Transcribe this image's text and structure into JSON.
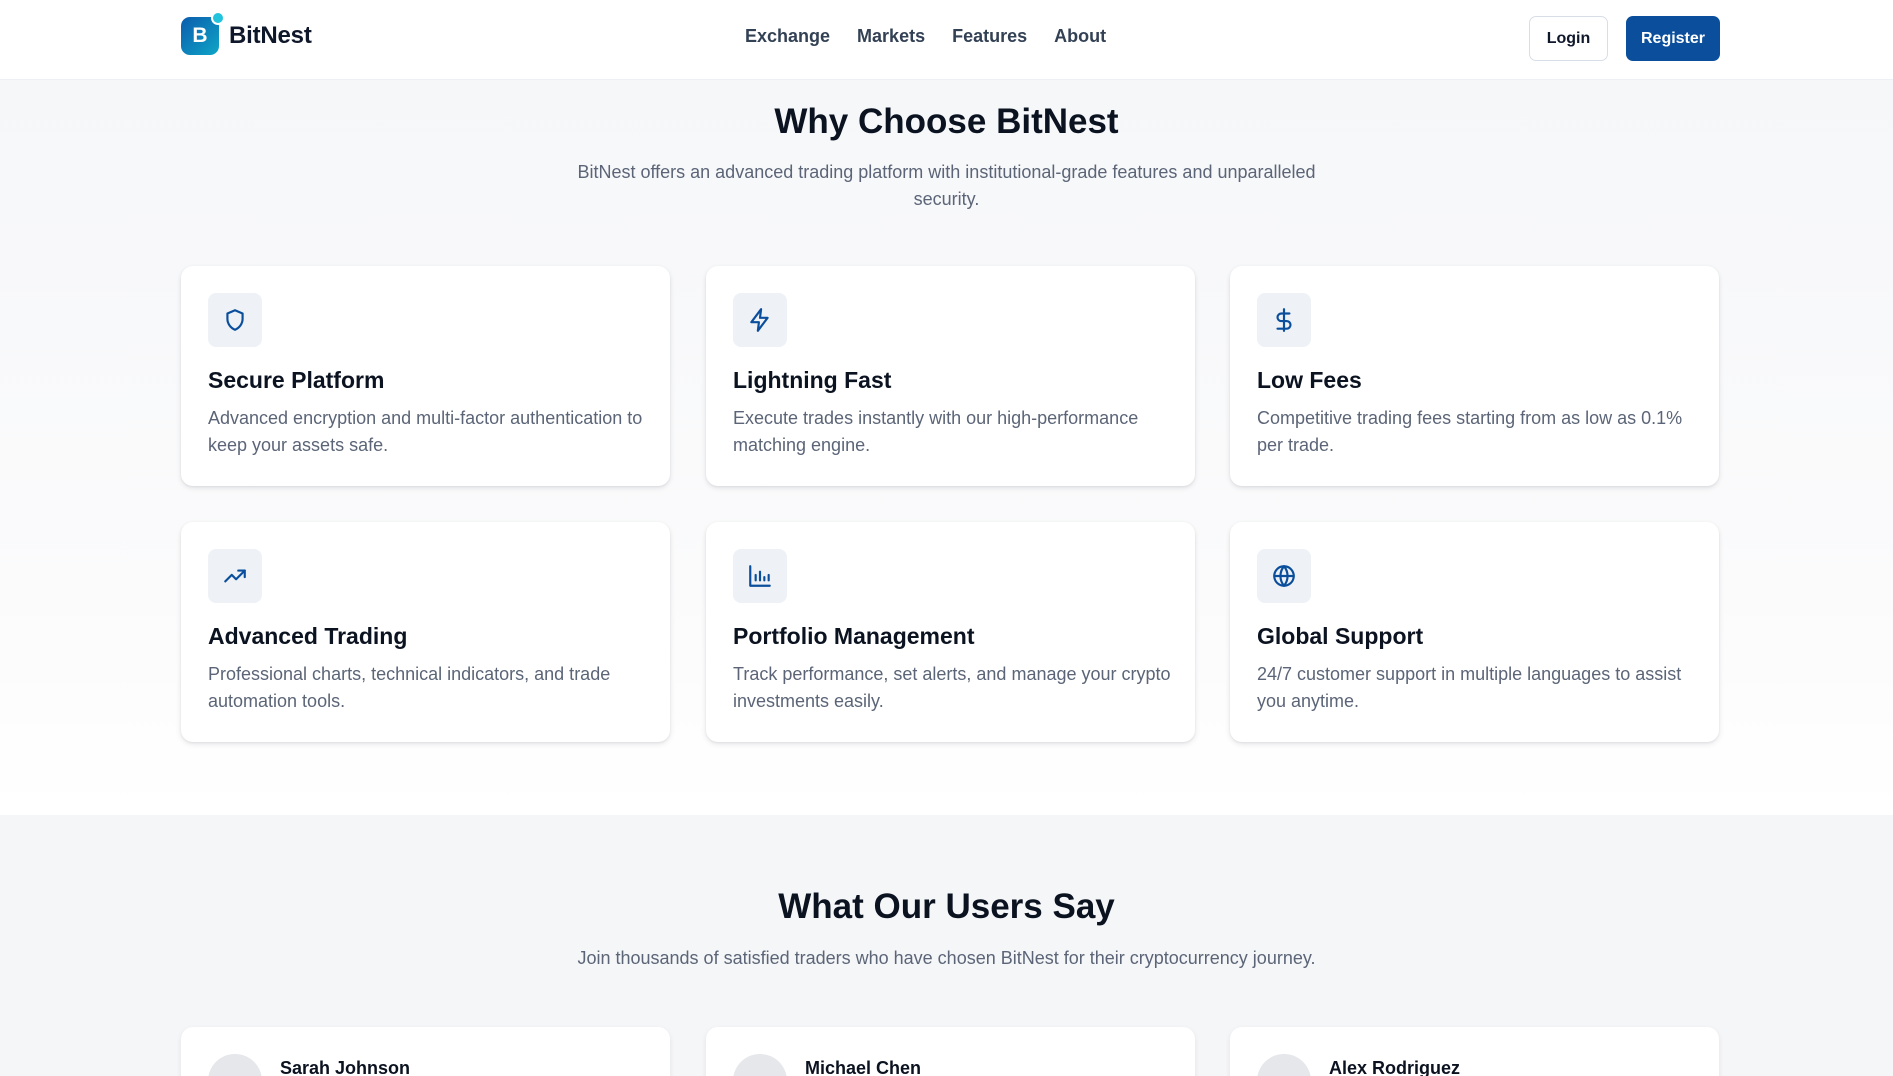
{
  "brand": {
    "logo_letter": "B",
    "name": "BitNest",
    "accent": "#0b4f9c"
  },
  "nav": {
    "items": [
      "Exchange",
      "Markets",
      "Features",
      "About"
    ]
  },
  "auth": {
    "login_label": "Login",
    "register_label": "Register"
  },
  "features": {
    "title": "Why Choose BitNest",
    "subtitle_line1": "BitNest offers an advanced trading platform with institutional-grade features and unparalleled",
    "subtitle_line2": "security.",
    "cards": [
      {
        "icon": "shield-icon",
        "title": "Secure Platform",
        "desc": "Advanced encryption and multi-factor authentication to keep your assets safe."
      },
      {
        "icon": "lightning-icon",
        "title": "Lightning Fast",
        "desc": "Execute trades instantly with our high-performance matching engine."
      },
      {
        "icon": "dollar-icon",
        "title": "Low Fees",
        "desc": "Competitive trading fees starting from as low as 0.1% per trade."
      },
      {
        "icon": "trending-up-icon",
        "title": "Advanced Trading",
        "desc": "Professional charts, technical indicators, and trade automation tools."
      },
      {
        "icon": "bar-chart-icon",
        "title": "Portfolio Management",
        "desc": "Track performance, set alerts, and manage your crypto investments easily."
      },
      {
        "icon": "globe-icon",
        "title": "Global Support",
        "desc": "24/7 customer support in multiple languages to assist you anytime."
      }
    ]
  },
  "testimonials": {
    "title": "What Our Users Say",
    "subtitle": "Join thousands of satisfied traders who have chosen BitNest for their cryptocurrency journey.",
    "users": [
      {
        "name": "Sarah Johnson"
      },
      {
        "name": "Michael Chen"
      },
      {
        "name": "Alex Rodriguez"
      }
    ]
  }
}
